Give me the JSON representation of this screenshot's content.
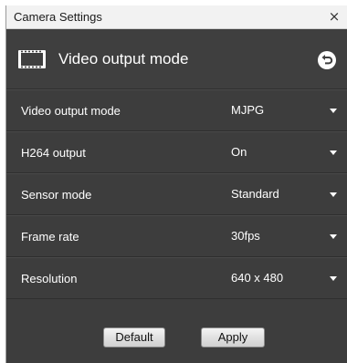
{
  "window": {
    "title": "Camera Settings",
    "close_label": "×"
  },
  "header": {
    "title": "Video output mode",
    "icon": "film-icon",
    "back_icon": "back-icon"
  },
  "settings": [
    {
      "label": "Video output mode",
      "value": "MJPG"
    },
    {
      "label": "H264 output",
      "value": "On"
    },
    {
      "label": "Sensor mode",
      "value": "Standard"
    },
    {
      "label": "Frame rate",
      "value": "30fps"
    },
    {
      "label": "Resolution",
      "value": "640 x 480"
    }
  ],
  "buttons": {
    "default_label": "Default",
    "apply_label": "Apply"
  },
  "colors": {
    "panel_bg": "#3d3d3d",
    "titlebar_bg": "#f2f2f2",
    "text": "#ffffff"
  }
}
